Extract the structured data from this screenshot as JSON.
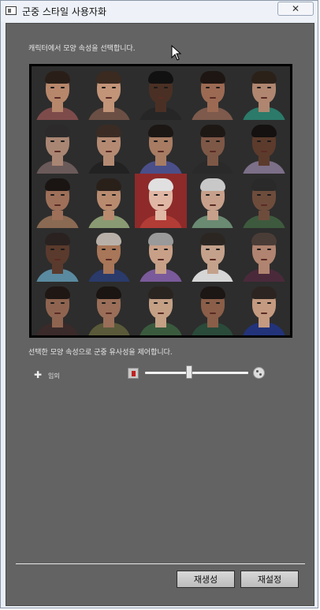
{
  "window": {
    "title": "군중 스타일 사용자화",
    "close_glyph": "✕"
  },
  "instruction": "캐릭터에서 모양 속성을 선택합니다.",
  "similarity_text": "선택한 모양 속성으로 군중 유사성을 제어합니다.",
  "random": {
    "plus": "✚",
    "label": "임의"
  },
  "slider": {
    "value_fraction": 0.43,
    "left_icon": "similar-crowd-icon",
    "right_icon": "diverse-crowd-icon"
  },
  "buttons": {
    "regenerate": "재생성",
    "reset": "재설정"
  },
  "grid": {
    "selected_index": 12,
    "faces": [
      {
        "skin": "#b7876b",
        "hair": "#2a1f18",
        "shirt": "#7e4b4b"
      },
      {
        "skin": "#c29478",
        "hair": "#3a2a20",
        "shirt": "#6b4f44"
      },
      {
        "skin": "#4a3024",
        "hair": "#111111",
        "shirt": "#262626"
      },
      {
        "skin": "#9c6a53",
        "hair": "#1e1612",
        "shirt": "#7d5a4c"
      },
      {
        "skin": "#b08670",
        "hair": "#2b2119",
        "shirt": "#2b7a6a"
      },
      {
        "skin": "#a98673",
        "hair": "#2c2a2a",
        "shirt": "#6b5a5a"
      },
      {
        "skin": "#b48a73",
        "hair": "#3a2c24",
        "shirt": "#222222"
      },
      {
        "skin": "#a77c63",
        "hair": "#1c1714",
        "shirt": "#4a4f8a"
      },
      {
        "skin": "#7e5846",
        "hair": "#1e1815",
        "shirt": "#2a2a2a"
      },
      {
        "skin": "#5c3b2c",
        "hair": "#141110",
        "shirt": "#7c6f88"
      },
      {
        "skin": "#9e7059",
        "hair": "#1a1513",
        "shirt": "#8a6a52"
      },
      {
        "skin": "#b88b6f",
        "hair": "#2a201a",
        "shirt": "#8a9a72"
      },
      {
        "skin": "#e0b7a4",
        "hair": "#e0e0e0",
        "shirt": "#b23c36"
      },
      {
        "skin": "#c7a08b",
        "hair": "#c8c8c8",
        "shirt": "#6a8a72"
      },
      {
        "skin": "#6e4c3c",
        "hair": "#2a2a2a",
        "shirt": "#3e5a3e"
      },
      {
        "skin": "#5a3a2c",
        "hair": "#2a2220",
        "shirt": "#5a8aa0"
      },
      {
        "skin": "#a87658",
        "hair": "#b8b0a8",
        "shirt": "#2a3a6a"
      },
      {
        "skin": "#c8a088",
        "hair": "#9a9a9a",
        "shirt": "#7a5a9a"
      },
      {
        "skin": "#c4a18b",
        "hair": "#2c2622",
        "shirt": "#d6d6d6"
      },
      {
        "skin": "#b08470",
        "hair": "#4a3c36",
        "shirt": "#4a2a3a"
      },
      {
        "skin": "#8e6450",
        "hair": "#1e1714",
        "shirt": "#3a2a2a"
      },
      {
        "skin": "#9a6e58",
        "hair": "#1a1512",
        "shirt": "#5a5a3a"
      },
      {
        "skin": "#c4a085",
        "hair": "#2a2420",
        "shirt": "#3a5a3e"
      },
      {
        "skin": "#8a5e48",
        "hair": "#1c1614",
        "shirt": "#2a4a3a"
      },
      {
        "skin": "#c49a80",
        "hair": "#2c2420",
        "shirt": "#22337a"
      }
    ]
  }
}
